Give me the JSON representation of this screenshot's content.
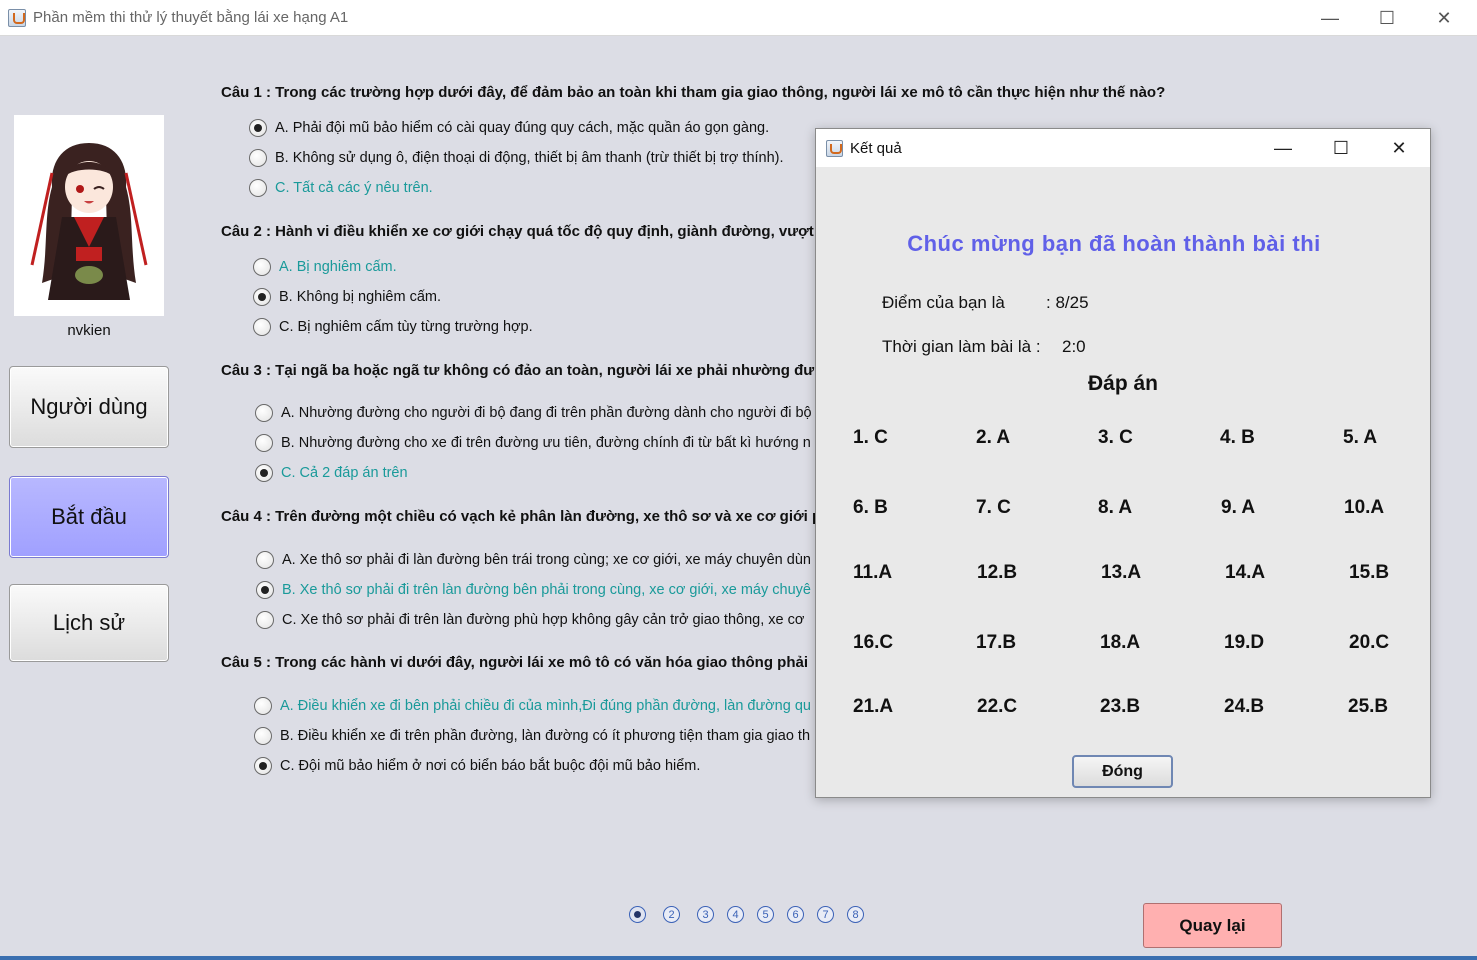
{
  "window": {
    "title": "Phần mềm thi thử lý thuyết bằng lái xe hạng A1"
  },
  "sidebar": {
    "username": "nvkien",
    "buttons": {
      "user": "Người dùng",
      "start": "Bắt đầu",
      "history": "Lịch sử"
    }
  },
  "questions": [
    {
      "text": "Câu 1 : Trong các trường hợp dưới đây, để đảm bảo an toàn khi tham gia giao thông, người lái xe mô tô cần thực hiện như thế nào?",
      "options": [
        "A. Phải đội mũ bảo hiểm có cài quay đúng quy cách, mặc quần áo gọn gàng.",
        "B. Không sử dụng ô, điện thoại di động, thiết bị âm thanh (trừ thiết bị trợ thính).",
        "C. Tất cả các ý nêu trên."
      ]
    },
    {
      "text": "Câu 2 : Hành vi điều khiển xe cơ giới chạy quá tốc độ quy định, giành đường, vượt",
      "options": [
        "A. Bị nghiêm cấm.",
        "B. Không bị nghiêm cấm.",
        "C. Bị nghiêm cấm tùy từng trường hợp."
      ]
    },
    {
      "text": "Câu 3 : Tại ngã ba hoặc ngã tư không có đảo an toàn, người lái xe phải nhường đư",
      "options": [
        "A. Nhường đường cho người đi bộ đang đi trên phần đường dành cho người đi bộ",
        "B. Nhường đường cho xe đi trên đường ưu tiên, đường chính đi từ bất kì hướng n",
        "C. Cả 2 đáp án trên"
      ]
    },
    {
      "text": "Câu 4 : Trên đường một chiều có vạch kẻ phân làn đường, xe thô sơ và xe cơ giới p",
      "options": [
        "A. Xe thô sơ phải đi làn đường bên trái trong cùng; xe cơ giới, xe máy chuyên dùn",
        "B. Xe thô sơ phải đi trên làn đường bên phải trong cùng, xe cơ giới, xe máy chuyê",
        "C. Xe thô sơ phải đi trên làn đường phù hợp không gây cản trở giao thông, xe cơ"
      ]
    },
    {
      "text": "Câu 5 : Trong các hành vi dưới đây, người lái xe mô tô có văn hóa giao thông phải",
      "options": [
        "A. Điều khiển xe đi bên phải chiều đi của mình,Đi đúng phần đường, làn đường qu",
        "B. Điều khiển xe đi trên phần đường, làn đường có ít phương tiện tham gia giao th",
        "C. Đội mũ bảo hiểm ở nơi có biển báo bắt buộc đội mũ bảo hiểm."
      ]
    }
  ],
  "pager": [
    "1",
    "2",
    "3",
    "4",
    "5",
    "6",
    "7",
    "8"
  ],
  "back_button": "Quay lại",
  "dialog": {
    "title": "Kết quả",
    "congrats": "Chúc mừng bạn đã hoàn thành bài thi",
    "score_label": "Điểm của bạn là",
    "score_value": ": 8/25",
    "time_label": "Thời gian làm bài là :",
    "time_value": "2:0",
    "answers_title": "Đáp án",
    "answers": [
      "1.  C",
      "2.  A",
      "3.  C",
      "4.  B",
      "5.  A",
      "6.  B",
      "7.  C",
      "8.  A",
      "9.  A",
      "10.A",
      "11.A",
      "12.B",
      "13.A",
      "14.A",
      "15.B",
      "16.C",
      "17.B",
      "18.A",
      "19.D",
      "20.C",
      "21.A",
      "22.C",
      "23.B",
      "24.B",
      "25.B"
    ],
    "close_button": "Đóng"
  },
  "colors": {
    "accent_blue": "#6060e8",
    "teal_text": "#1a9a9a",
    "start_button": "#a0a0ff",
    "back_button": "#ffb0b0"
  }
}
